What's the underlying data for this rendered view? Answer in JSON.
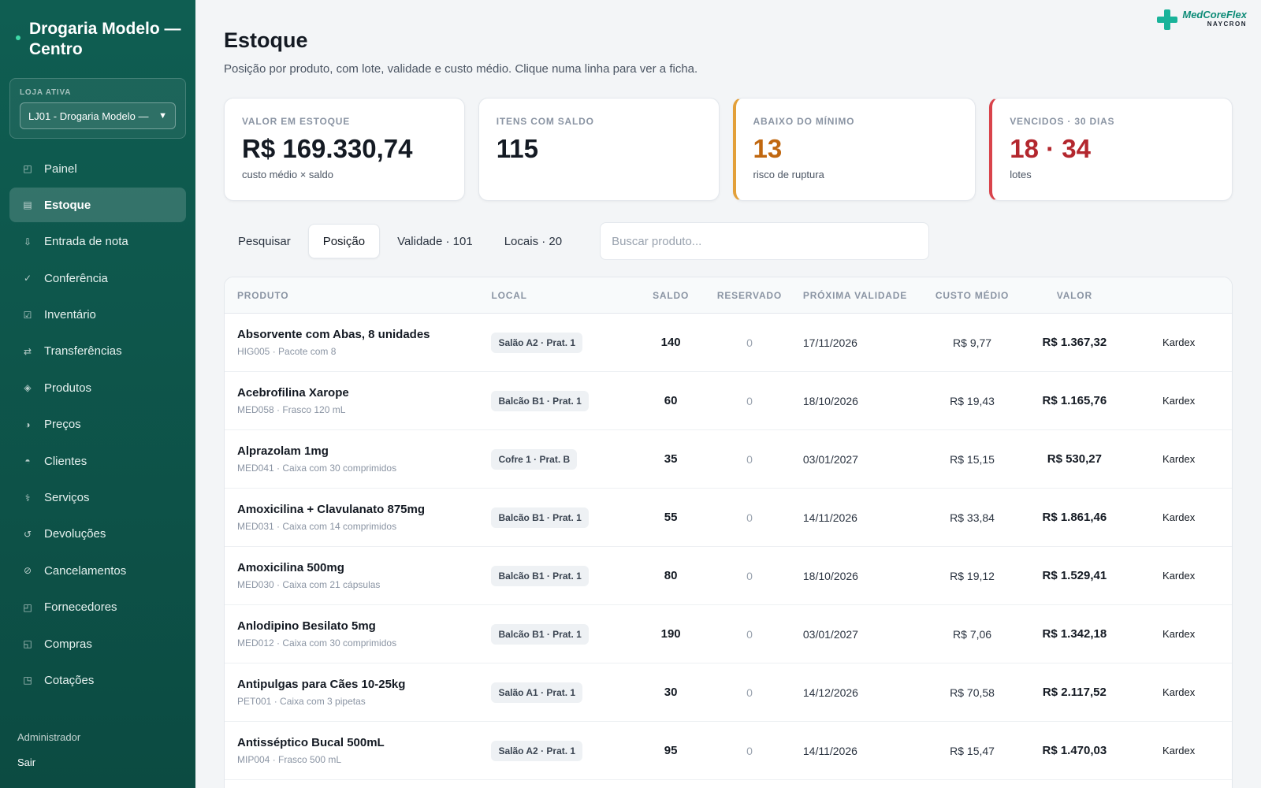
{
  "sidebar": {
    "brand": "Drogaria Modelo — Centro",
    "store_label": "LOJA ATIVA",
    "store_value": "LJ01 - Drogaria Modelo —",
    "items": [
      {
        "label": "Painel",
        "icon": "◰"
      },
      {
        "label": "Estoque",
        "icon": "▤"
      },
      {
        "label": "Entrada de nota",
        "icon": "⇩"
      },
      {
        "label": "Conferência",
        "icon": "✓"
      },
      {
        "label": "Inventário",
        "icon": "☑"
      },
      {
        "label": "Transferências",
        "icon": "⇄"
      },
      {
        "label": "Produtos",
        "icon": "◈"
      },
      {
        "label": "Preços",
        "icon": "◑"
      },
      {
        "label": "Clientes",
        "icon": "◓"
      },
      {
        "label": "Serviços",
        "icon": "⚕"
      },
      {
        "label": "Devoluções",
        "icon": "↺"
      },
      {
        "label": "Cancelamentos",
        "icon": "⊘"
      },
      {
        "label": "Fornecedores",
        "icon": "◰"
      },
      {
        "label": "Compras",
        "icon": "◱"
      },
      {
        "label": "Cotações",
        "icon": "◳"
      }
    ],
    "user": "Administrador",
    "logout": "Sair"
  },
  "logo": {
    "line1": "MedCoreFlex",
    "line2": "NAYCRON"
  },
  "header": {
    "title": "Estoque",
    "subtitle": "Posição por produto, com lote, validade e custo médio. Clique numa linha para ver a ficha."
  },
  "cards": [
    {
      "label": "VALOR EM ESTOQUE",
      "value": "R$ 169.330,74",
      "note": "custo médio × saldo"
    },
    {
      "label": "ITENS COM SALDO",
      "value": "115",
      "note": ""
    },
    {
      "label": "ABAIXO DO MÍNIMO",
      "value": "13",
      "note": "risco de ruptura"
    },
    {
      "label": "VENCIDOS · 30 DIAS",
      "value": "18 · 34",
      "note": "lotes"
    }
  ],
  "tabs": [
    {
      "label": "Pesquisar"
    },
    {
      "label": "Posição"
    },
    {
      "label": "Validade · 101"
    },
    {
      "label": "Locais · 20"
    }
  ],
  "search": {
    "placeholder": "Buscar produto..."
  },
  "table": {
    "headers": {
      "produto": "PRODUTO",
      "local": "LOCAL",
      "saldo": "SALDO",
      "reservado": "RESERVADO",
      "validade": "PRÓXIMA VALIDADE",
      "custo": "CUSTO MÉDIO",
      "valor": "VALOR"
    },
    "action_label": "Kardex",
    "rows": [
      {
        "name": "Absorvente com Abas, 8 unidades",
        "sub": "HIG005 · Pacote com 8",
        "local": "Salão A2 · Prat. 1",
        "saldo": "140",
        "reservado": "0",
        "validade": "17/11/2026",
        "custo": "R$ 9,77",
        "valor": "R$ 1.367,32"
      },
      {
        "name": "Acebrofilina Xarope",
        "sub": "MED058 · Frasco 120 mL",
        "local": "Balcão B1 · Prat. 1",
        "saldo": "60",
        "reservado": "0",
        "validade": "18/10/2026",
        "custo": "R$ 19,43",
        "valor": "R$ 1.165,76"
      },
      {
        "name": "Alprazolam 1mg",
        "sub": "MED041 · Caixa com 30 comprimidos",
        "local": "Cofre 1 · Prat. B",
        "saldo": "35",
        "reservado": "0",
        "validade": "03/01/2027",
        "custo": "R$ 15,15",
        "valor": "R$ 530,27"
      },
      {
        "name": "Amoxicilina + Clavulanato 875mg",
        "sub": "MED031 · Caixa com 14 comprimidos",
        "local": "Balcão B1 · Prat. 1",
        "saldo": "55",
        "reservado": "0",
        "validade": "14/11/2026",
        "custo": "R$ 33,84",
        "valor": "R$ 1.861,46"
      },
      {
        "name": "Amoxicilina 500mg",
        "sub": "MED030 · Caixa com 21 cápsulas",
        "local": "Balcão B1 · Prat. 1",
        "saldo": "80",
        "reservado": "0",
        "validade": "18/10/2026",
        "custo": "R$ 19,12",
        "valor": "R$ 1.529,41"
      },
      {
        "name": "Anlodipino Besilato 5mg",
        "sub": "MED012 · Caixa com 30 comprimidos",
        "local": "Balcão B1 · Prat. 1",
        "saldo": "190",
        "reservado": "0",
        "validade": "03/01/2027",
        "custo": "R$ 7,06",
        "valor": "R$ 1.342,18"
      },
      {
        "name": "Antipulgas para Cães 10-25kg",
        "sub": "PET001 · Caixa com 3 pipetas",
        "local": "Salão A1 · Prat. 1",
        "saldo": "30",
        "reservado": "0",
        "validade": "14/12/2026",
        "custo": "R$ 70,58",
        "valor": "R$ 2.117,52"
      },
      {
        "name": "Antisséptico Bucal 500mL",
        "sub": "MIP004 · Frasco 500 mL",
        "local": "Salão A2 · Prat. 1",
        "saldo": "95",
        "reservado": "0",
        "validade": "14/11/2026",
        "custo": "R$ 15,47",
        "valor": "R$ 1.470,03"
      }
    ]
  },
  "colors": {
    "sidebar": "#0f5e52",
    "accent": "#19b39a",
    "warning": "#c0670f",
    "danger": "#b3272e"
  }
}
